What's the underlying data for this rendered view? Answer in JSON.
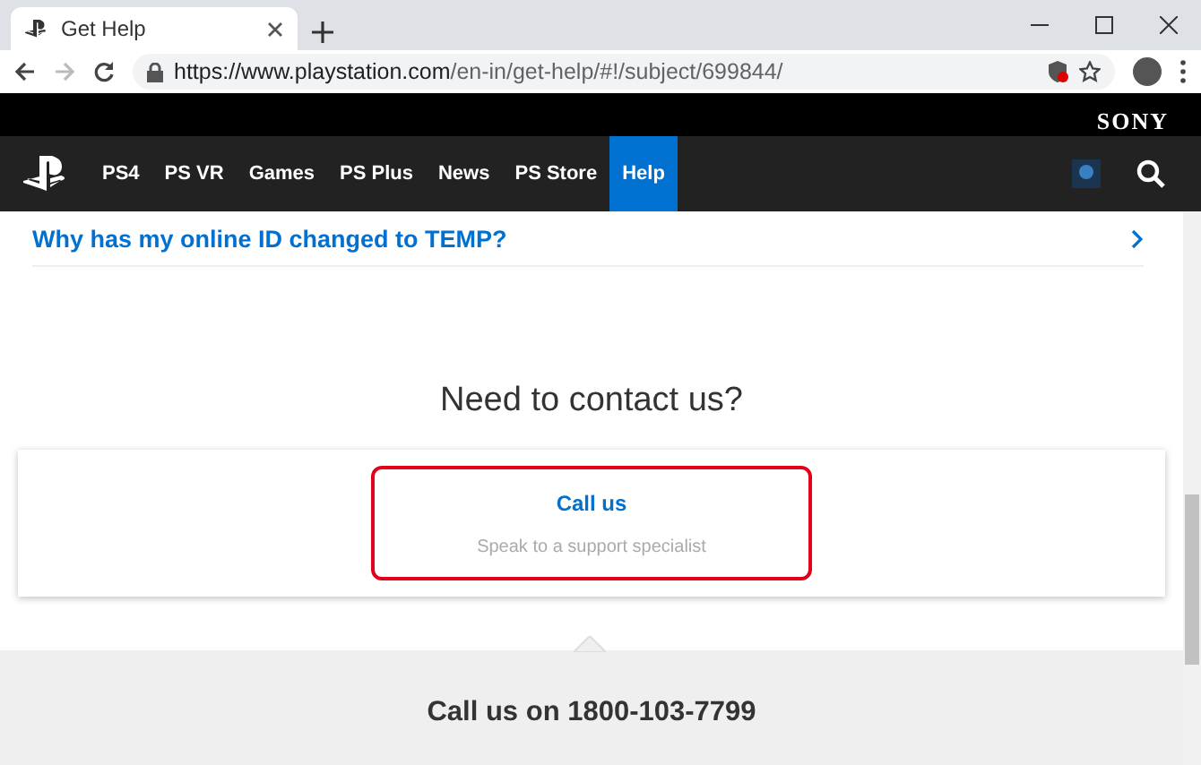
{
  "browser": {
    "tab_title": "Get Help",
    "url_host": "https://www.playstation.com",
    "url_path": "/en-in/get-help/#!/subject/699844/"
  },
  "brand": "SONY",
  "nav": {
    "items": [
      {
        "label": "PS4",
        "selected": false
      },
      {
        "label": "PS VR",
        "selected": false
      },
      {
        "label": "Games",
        "selected": false
      },
      {
        "label": "PS Plus",
        "selected": false
      },
      {
        "label": "News",
        "selected": false
      },
      {
        "label": "PS Store",
        "selected": false
      },
      {
        "label": "Help",
        "selected": true
      }
    ]
  },
  "faq_link": "Why has my online ID changed to TEMP?",
  "contact": {
    "heading": "Need to contact us?",
    "option_title": "Call us",
    "option_subtitle": "Speak to a support specialist",
    "highlighted": true
  },
  "call_heading": "Call us on 1800-103-7799"
}
